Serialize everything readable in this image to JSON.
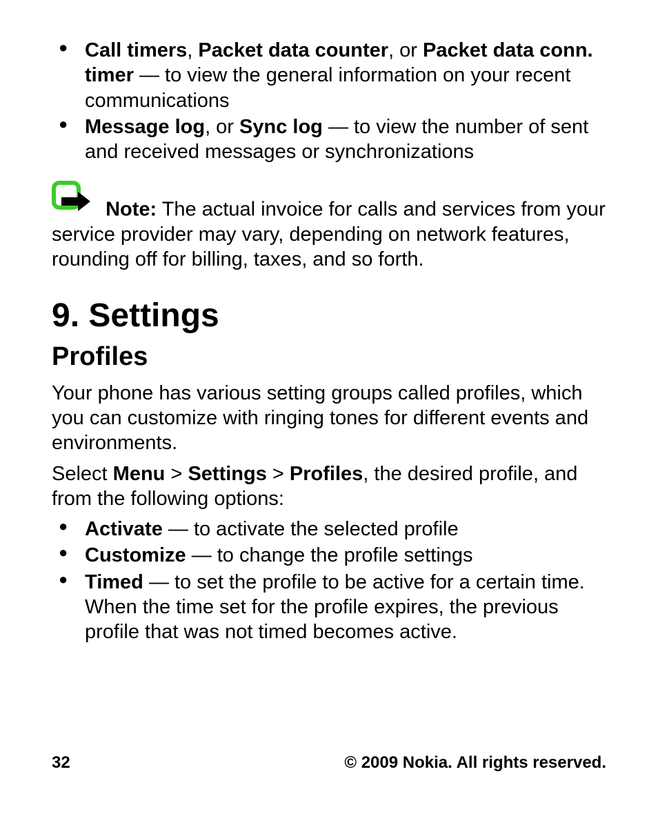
{
  "bullets_top": [
    {
      "bold_parts": [
        "Call timers",
        "Packet data counter",
        "Packet data conn. timer"
      ],
      "sep1": ", ",
      "sep2": ", or ",
      "tail": " — to view the general information on your recent communications"
    },
    {
      "bold_parts": [
        "Message log",
        "Sync log"
      ],
      "sep1": ", or ",
      "tail": " — to view the number of sent and received messages or synchronizations"
    }
  ],
  "note": {
    "label": "Note:",
    "text": "  The actual invoice for calls and services from your service provider may vary, depending on network features, rounding off for billing, taxes, and so forth."
  },
  "chapter": "9.  Settings",
  "section": "Profiles",
  "para1": "Your phone has various setting groups called profiles, which you can customize with ringing tones for different events and environments.",
  "para2": {
    "pre": "Select ",
    "b1": "Menu",
    "gt": "  >  ",
    "b2": "Settings",
    "b3": "Profiles",
    "post": ", the desired profile, and from the following options:"
  },
  "bullets_bottom": [
    {
      "bold": "Activate",
      "tail": "  — to activate the selected profile"
    },
    {
      "bold": "Customize",
      "tail": "  — to change the profile settings"
    },
    {
      "bold": "Timed",
      "tail": "  — to set the profile to be active for a certain time. When the time set for the profile expires, the previous profile that was not timed becomes active."
    }
  ],
  "footer": {
    "page": "32",
    "copyright": "© 2009 Nokia. All rights reserved."
  }
}
